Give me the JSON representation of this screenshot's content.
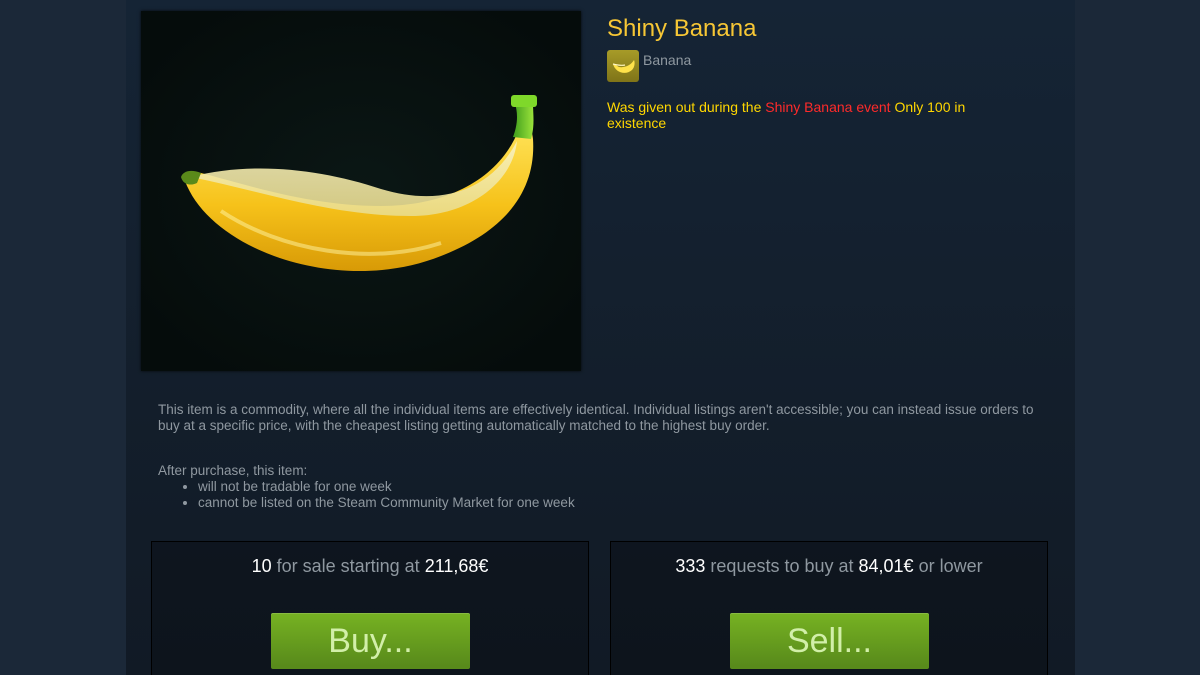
{
  "item": {
    "name": "Shiny Banana",
    "game_name": "Banana",
    "game_icon": "banana-icon",
    "image": "banana-image",
    "description_prefix": "Was given out during the ",
    "description_event": "Shiny Banana event",
    "description_suffix": " Only 100 in existence"
  },
  "notes": {
    "commodity": "This item is a commodity, where all the individual items are effectively identical. Individual listings aren't accessible; you can instead issue orders to buy at a specific price, with the cheapest listing getting automatically matched to the highest buy order.",
    "after_purchase_heading": "After purchase, this item:",
    "restrictions": [
      "will not be tradable for one week",
      "cannot be listed on the Steam Community Market for one week"
    ]
  },
  "sell_orders": {
    "count": "10",
    "text": " for sale starting at ",
    "price": "211,68€",
    "button_label": "Buy..."
  },
  "buy_orders": {
    "count": "333",
    "text": " requests to buy at ",
    "price": "84,01€",
    "suffix": " or lower",
    "button_label": "Sell..."
  },
  "colors": {
    "background": "#1b2838",
    "item_name": "#f7c735",
    "description": "#ffd700",
    "event_highlight": "#ff2a2a",
    "muted_text": "#8f98a0",
    "button_green": "#75b022",
    "button_text": "#d2efa9"
  }
}
